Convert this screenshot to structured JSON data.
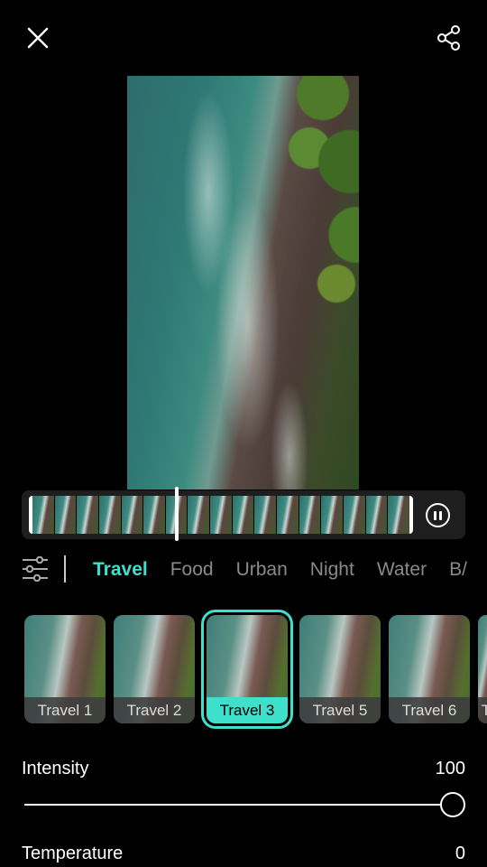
{
  "toolbar": {
    "close_icon": "close-icon",
    "share_icon": "share-icon"
  },
  "timeline": {
    "playhead_position": 0.38,
    "pause_icon": "pause-icon"
  },
  "categories": {
    "adjust_icon": "sliders-icon",
    "items": [
      {
        "label": "Travel",
        "active": true
      },
      {
        "label": "Food",
        "active": false
      },
      {
        "label": "Urban",
        "active": false
      },
      {
        "label": "Night",
        "active": false
      },
      {
        "label": "Water",
        "active": false
      },
      {
        "label": "B/",
        "active": false
      }
    ]
  },
  "filters": {
    "items": [
      {
        "label": "Travel 1",
        "selected": false
      },
      {
        "label": "Travel 2",
        "selected": false
      },
      {
        "label": "Travel 3",
        "selected": true
      },
      {
        "label": "Travel 5",
        "selected": false
      },
      {
        "label": "Travel 6",
        "selected": false
      },
      {
        "label": "T",
        "selected": false
      }
    ]
  },
  "params": {
    "intensity": {
      "label": "Intensity",
      "value": "100",
      "fraction": 1.0
    },
    "temperature": {
      "label": "Temperature",
      "value": "0"
    }
  },
  "colors": {
    "accent": "#3ee0cc",
    "background": "#000000",
    "tab_inactive": "#8a8a8a"
  }
}
